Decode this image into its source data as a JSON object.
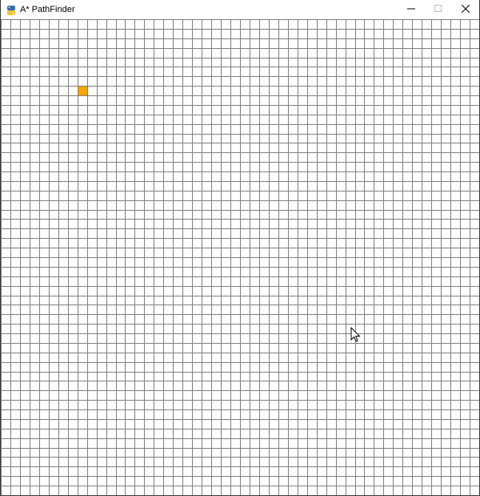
{
  "window": {
    "title": "A* PathFinder",
    "icon": "python-icon"
  },
  "titlebar_buttons": [
    {
      "name": "minimize-button",
      "icon": "minimize-icon"
    },
    {
      "name": "maximize-button",
      "icon": "maximize-icon"
    },
    {
      "name": "close-button",
      "icon": "close-icon"
    }
  ],
  "grid": {
    "columns": 50,
    "rows": 50,
    "line_color": "#7f7f7f",
    "background": "#ffffff"
  },
  "start_node": {
    "row": 7,
    "col": 8,
    "color": "#ffa500"
  },
  "colors": {
    "accent": "#ffa500"
  }
}
